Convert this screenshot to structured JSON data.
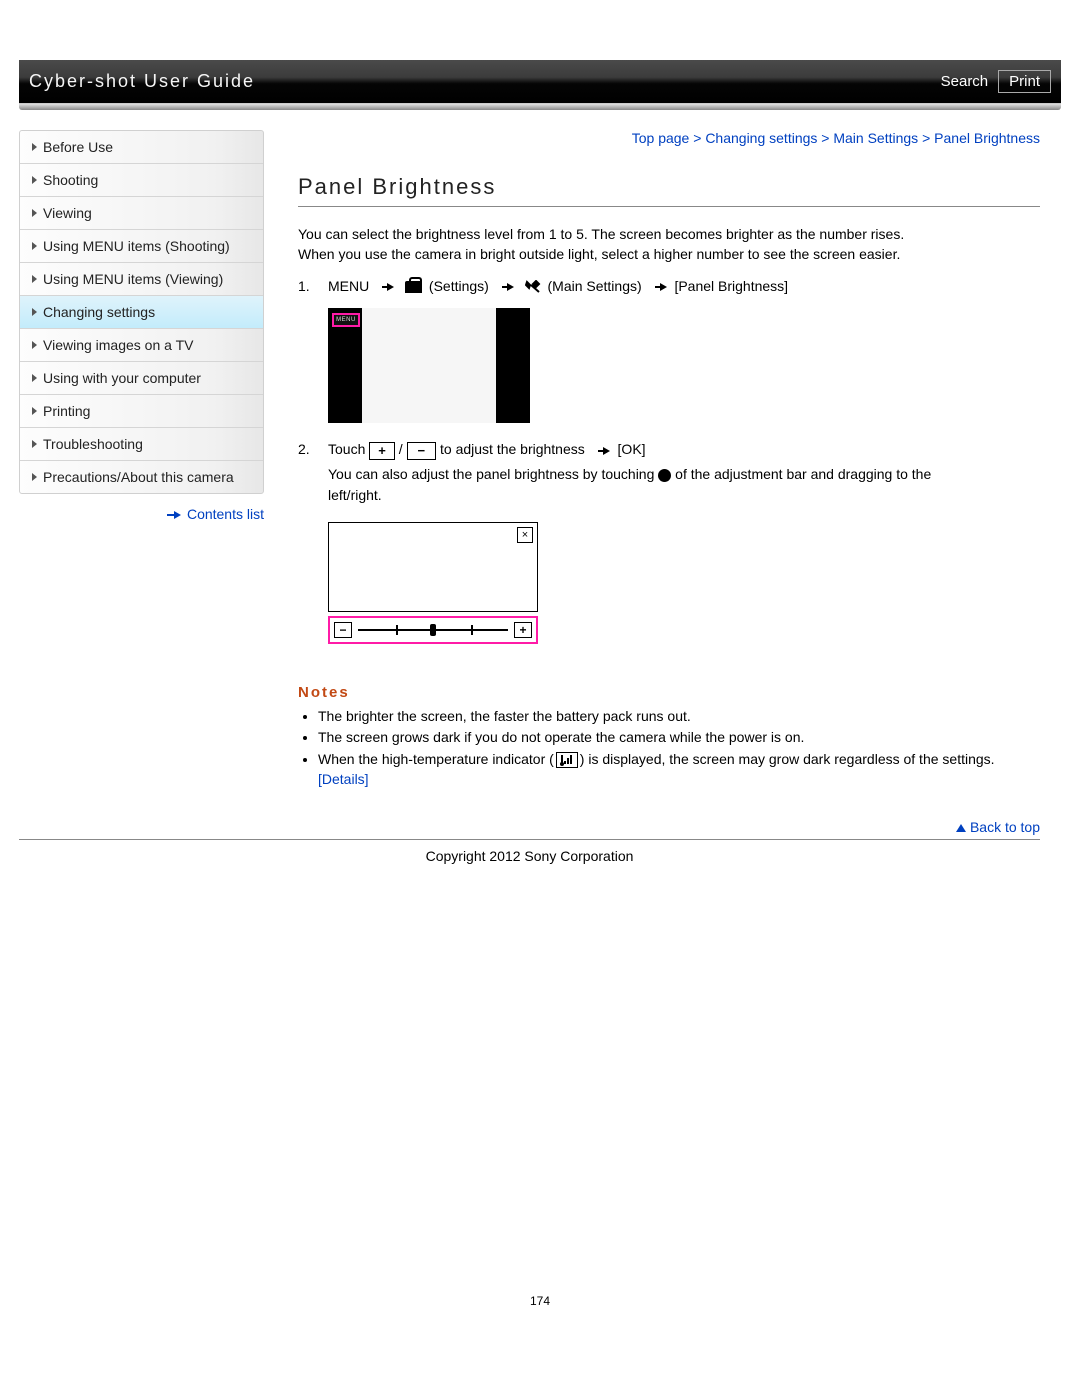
{
  "header": {
    "title": "Cyber-shot User Guide",
    "search": "Search",
    "print": "Print"
  },
  "sidebar": {
    "items": [
      {
        "label": "Before Use"
      },
      {
        "label": "Shooting"
      },
      {
        "label": "Viewing"
      },
      {
        "label": "Using MENU items (Shooting)"
      },
      {
        "label": "Using MENU items (Viewing)"
      },
      {
        "label": "Changing settings"
      },
      {
        "label": "Viewing images on a TV"
      },
      {
        "label": "Using with your computer"
      },
      {
        "label": "Printing"
      },
      {
        "label": "Troubleshooting"
      },
      {
        "label": "Precautions/About this camera"
      }
    ],
    "contents_list": "Contents list"
  },
  "breadcrumb": {
    "t0": "Top page",
    "t1": "Changing settings",
    "t2": "Main Settings",
    "t3": "Panel Brightness",
    "sep": " > "
  },
  "page_title": "Panel Brightness",
  "intro_l1": "You can select the brightness level from 1 to 5. The screen becomes brighter as the number rises.",
  "intro_l2": "When you use the camera in bright outside light, select a higher number to see the screen easier.",
  "step1": {
    "num": "1.",
    "menu": "MENU",
    "settings": "(Settings)",
    "main_settings": "(Main Settings)",
    "target": "[Panel Brightness]"
  },
  "step2": {
    "num": "2.",
    "touch": "Touch",
    "slash": " / ",
    "adjust": "to adjust the brightness",
    "ok": "[OK]",
    "l2a": "You can also adjust the panel brightness by touching",
    "l2b": "of the adjustment bar and dragging to the",
    "l2c": "left/right."
  },
  "notes": {
    "title": "Notes",
    "n1": "The brighter the screen, the faster the battery pack runs out.",
    "n2": "The screen grows dark if you do not operate the camera while the power is on.",
    "n3a": "When the high-temperature indicator (",
    "n3b": ") is displayed, the screen may grow dark regardless of the settings. ",
    "details": "[Details]"
  },
  "back_to_top": "Back to top",
  "copyright": "Copyright 2012 Sony Corporation",
  "page_number": "174"
}
